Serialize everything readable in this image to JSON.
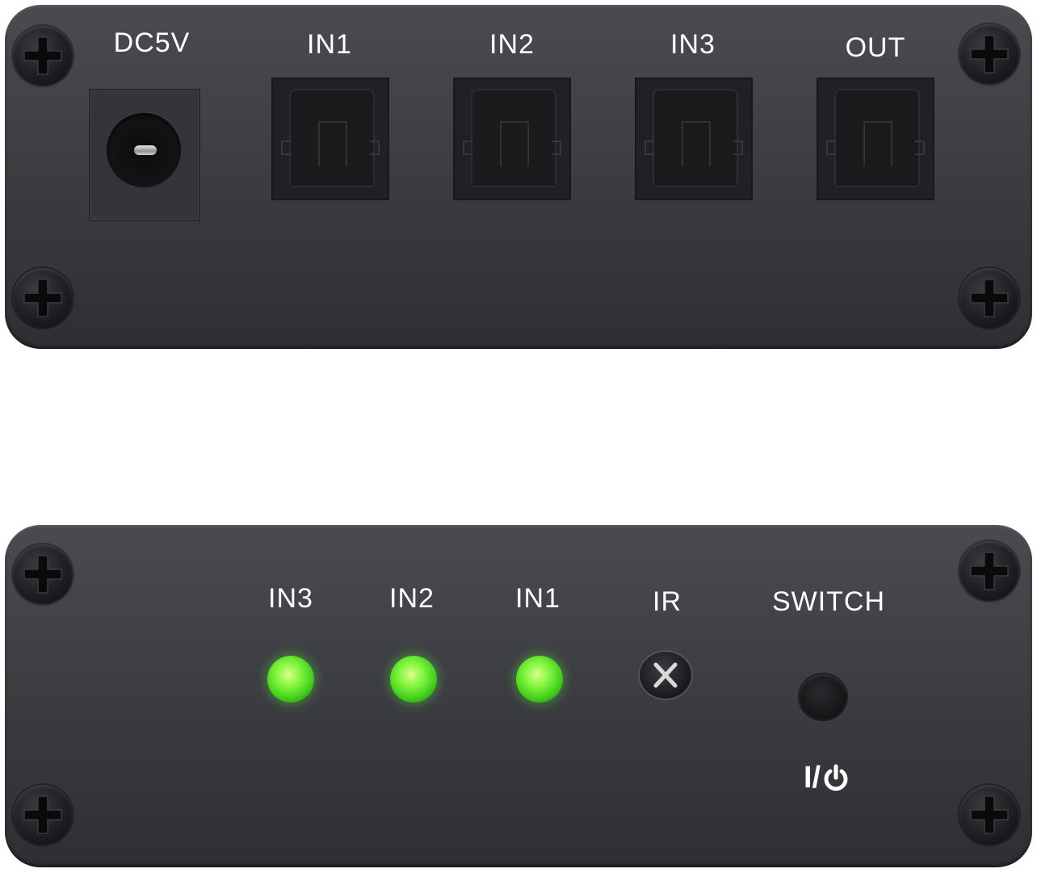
{
  "rear_panel": {
    "labels": {
      "dc": "DC5V",
      "in1": "IN1",
      "in2": "IN2",
      "in3": "IN3",
      "out": "OUT"
    }
  },
  "front_panel": {
    "labels": {
      "in3": "IN3",
      "in2": "IN2",
      "in1": "IN1",
      "ir": "IR",
      "switch": "SWITCH",
      "power_slash": "I/"
    },
    "leds": [
      {
        "name": "IN3",
        "state": "on",
        "color": "#4fdc26"
      },
      {
        "name": "IN2",
        "state": "on",
        "color": "#4fdc26"
      },
      {
        "name": "IN1",
        "state": "on",
        "color": "#4fdc26"
      }
    ]
  },
  "colors": {
    "panel": "#3d3e42",
    "label_text": "#ffffff",
    "led_green": "#4fdc26"
  },
  "icons": [
    "phillips-screw-icon",
    "dc-jack-icon",
    "toslink-port-icon",
    "led-icon",
    "ir-sensor-icon",
    "power-icon"
  ]
}
